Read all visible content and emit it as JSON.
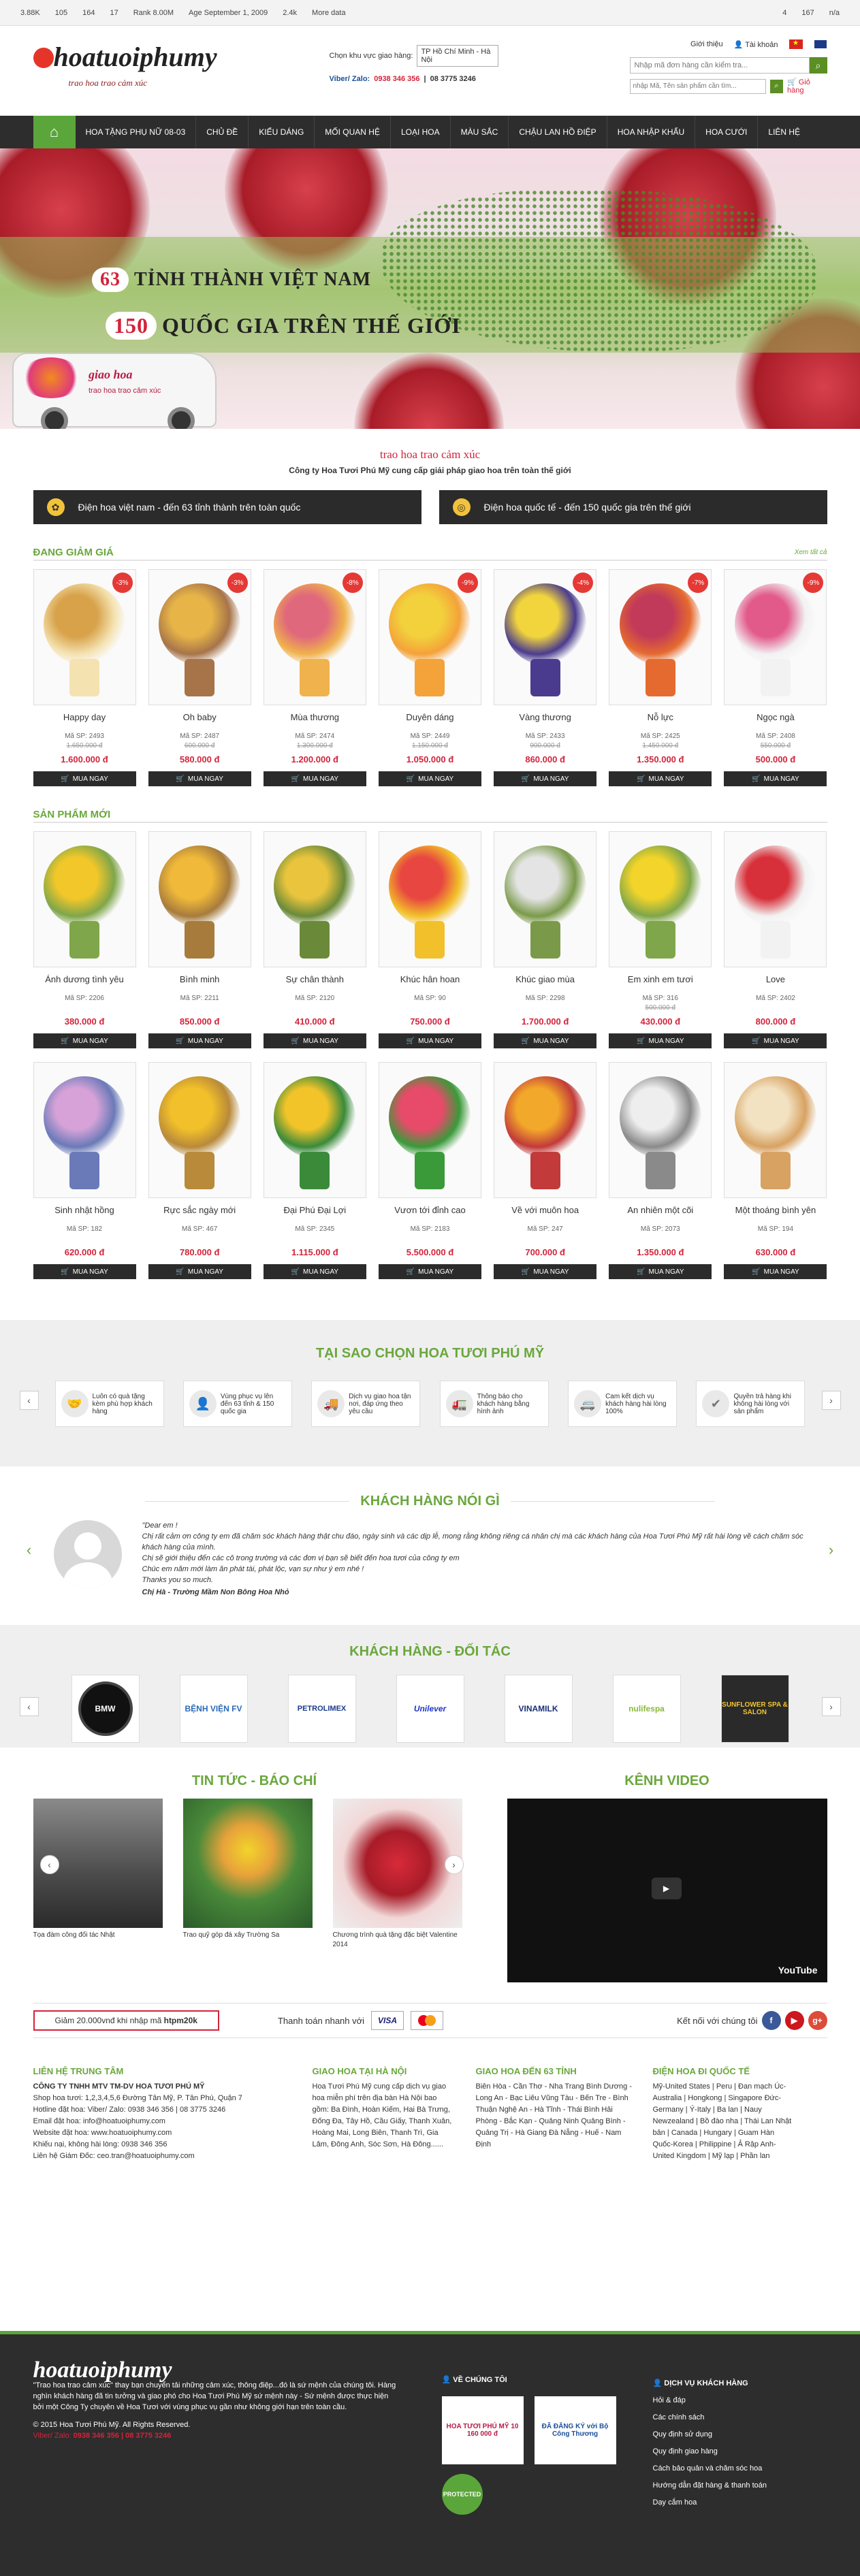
{
  "seobar": {
    "items": [
      "3.88K",
      "105",
      "164",
      "17",
      "Rank 8.00M",
      "Age September 1, 2009",
      "2.4k",
      "More data"
    ],
    "right": [
      "4",
      "167",
      "n/a"
    ]
  },
  "header": {
    "logo_text": "hoatuoiphumy",
    "logo_sub": ".com",
    "slogan": "trao hoa trao cảm xúc",
    "region_label": "Chọn khu vực giao hàng:",
    "region_value": "TP Hồ Chí Minh - Hà Nội",
    "hotline_label": "Viber/ Zalo:",
    "hotline1": "0938 346 356",
    "hotline2": "08 3775 3246",
    "intro": "Giới thiệu",
    "account": "Tài khoản",
    "search_placeholder": "Nhập mã đơn hàng cần kiểm tra...",
    "search2_placeholder": "nhập Mã, Tên sản phẩm cần tìm...",
    "cart": "Giỏ hàng"
  },
  "nav": [
    "HOA TẶNG PHỤ NỮ 08-03",
    "CHỦ ĐỀ",
    "KIỂU DÁNG",
    "MỐI QUAN HỆ",
    "LOẠI HOA",
    "MÀU SẮC",
    "CHẬU LAN HỒ ĐIỆP",
    "HOA NHẬP KHẨU",
    "HOA CƯỚI",
    "LIÊN HỆ"
  ],
  "banner": {
    "num1": "63",
    "text1": "TỈNH THÀNH VIỆT NAM",
    "num2": "150",
    "text2": "QUỐC GIA TRÊN THẾ GIỚI",
    "van_logo": "giao hoa",
    "van_sub": "trao hoa trao cảm xúc"
  },
  "tagline": {
    "title": "trao hoa trao cảm xúc",
    "sub": "Công ty Hoa Tươi Phú Mỹ cung cấp giải pháp giao hoa trên toàn thế giới"
  },
  "boxes": [
    "Điện hoa việt nam - đến 63 tỉnh thành trên toàn quốc",
    "Điện hoa quốc tế - đến 150 quốc gia trên thế giới"
  ],
  "sale": {
    "title": "ĐANG GIẢM GIÁ",
    "all": "Xem tất cả",
    "products": [
      {
        "name": "Happy day",
        "code": "Mã SP: 2493",
        "old": "1.650.000 đ",
        "price": "1.600.000 đ",
        "disc": "-3%",
        "c1": "#d8a24a",
        "c2": "#f4e2b0"
      },
      {
        "name": "Oh baby",
        "code": "Mã SP: 2487",
        "old": "600.000 đ",
        "price": "580.000 đ",
        "disc": "-3%",
        "c1": "#e6b447",
        "c2": "#a7744a"
      },
      {
        "name": "Mùa thương",
        "code": "Mã SP: 2474",
        "old": "1.300.000 đ",
        "price": "1.200.000 đ",
        "disc": "-8%",
        "c1": "#e0687c",
        "c2": "#f0b24d"
      },
      {
        "name": "Duyên dáng",
        "code": "Mã SP: 2449",
        "old": "1.150.000 đ",
        "price": "1.050.000 đ",
        "disc": "-9%",
        "c1": "#f2d13c",
        "c2": "#f4a23a"
      },
      {
        "name": "Vàng thương",
        "code": "Mã SP: 2433",
        "old": "900.000 đ",
        "price": "860.000 đ",
        "disc": "-4%",
        "c1": "#f2d53c",
        "c2": "#4a3b8e"
      },
      {
        "name": "Nỗ lực",
        "code": "Mã SP: 2425",
        "old": "1.450.000 đ",
        "price": "1.350.000 đ",
        "disc": "-7%",
        "c1": "#c23a59",
        "c2": "#e56a2f"
      },
      {
        "name": "Ngọc ngà",
        "code": "Mã SP: 2408",
        "old": "550.000 đ",
        "price": "500.000 đ",
        "disc": "-9%",
        "c1": "#e25a8a",
        "c2": "#f2f2f2"
      }
    ]
  },
  "newp": {
    "title": "SẢN PHẨM MỚI",
    "row1": [
      {
        "name": "Ánh dương tình yêu",
        "code": "Mã SP: 2206",
        "old": "",
        "price": "380.000 đ",
        "c1": "#f2c72a",
        "c2": "#7fa64a"
      },
      {
        "name": "Bình minh",
        "code": "Mã SP: 2211",
        "old": "",
        "price": "850.000 đ",
        "c1": "#f0b93a",
        "c2": "#a77b3c"
      },
      {
        "name": "Sự chân thành",
        "code": "Mã SP: 2120",
        "old": "",
        "price": "410.000 đ",
        "c1": "#e9c43c",
        "c2": "#6a8a3a"
      },
      {
        "name": "Khúc hân hoan",
        "code": "Mã SP: 90",
        "old": "",
        "price": "750.000 đ",
        "c1": "#e84640",
        "c2": "#f2c02a"
      },
      {
        "name": "Khúc giao mùa",
        "code": "Mã SP: 2298",
        "old": "",
        "price": "1.700.000 đ",
        "c1": "#e4e4e4",
        "c2": "#7a9a4a"
      },
      {
        "name": "Em xinh em tươi",
        "code": "Mã SP: 316",
        "old": "500.000 đ",
        "price": "430.000 đ",
        "c1": "#f2d42a",
        "c2": "#7fa64a"
      },
      {
        "name": "Love",
        "code": "Mã SP: 2402",
        "old": "",
        "price": "800.000 đ",
        "c1": "#d8303a",
        "c2": "#f2f2f2"
      }
    ],
    "row2": [
      {
        "name": "Sinh nhật hồng",
        "code": "Mã SP: 182",
        "old": "",
        "price": "620.000 đ",
        "c1": "#d6a2d8",
        "c2": "#6a7ab8"
      },
      {
        "name": "Rực sắc ngày mới",
        "code": "Mã SP: 467",
        "old": "",
        "price": "780.000 đ",
        "c1": "#f2c02a",
        "c2": "#b88a3a"
      },
      {
        "name": "Đại Phú Đại Lợi",
        "code": "Mã SP: 2345",
        "old": "",
        "price": "1.115.000 đ",
        "c1": "#f2c42a",
        "c2": "#3a8a3a"
      },
      {
        "name": "Vươn tới đỉnh cao",
        "code": "Mã SP: 2183",
        "old": "",
        "price": "5.500.000 đ",
        "c1": "#e84a6a",
        "c2": "#3a9a3a"
      },
      {
        "name": "Về với muôn hoa",
        "code": "Mã SP: 247",
        "old": "",
        "price": "700.000 đ",
        "c1": "#f2a82a",
        "c2": "#c23a3a"
      },
      {
        "name": "An nhiên một cõi",
        "code": "Mã SP: 2073",
        "old": "",
        "price": "1.350.000 đ",
        "c1": "#eeeeee",
        "c2": "#8a8a8a"
      },
      {
        "name": "Một thoáng bình yên",
        "code": "Mã SP: 194",
        "old": "",
        "price": "630.000 đ",
        "c1": "#f2e2c2",
        "c2": "#d8a262"
      }
    ],
    "buy": "MUA NGAY"
  },
  "why": {
    "title": "TẠI SAO CHỌN HOA TƯƠI PHÚ MỸ",
    "items": [
      "Luôn có quà tặng kèm phù hợp khách hàng",
      "Vùng phục vụ lên đến 63 tỉnh & 150 quốc gia",
      "Dịch vụ giao hoa tận nơi, đáp ứng theo yêu cầu",
      "Thông báo cho khách hàng bằng hình ảnh",
      "Cam kết dịch vụ khách hàng hài lòng 100%",
      "Quyền trả hàng khi không hài lòng với sản phẩm"
    ]
  },
  "testimonial": {
    "title": "KHÁCH HÀNG NÓI GÌ",
    "greeting": "\"Dear em !",
    "l1": "Chị rất cảm ơn công ty em đã chăm sóc khách hàng thật chu đáo, ngày sinh và các dịp lễ, mong rằng không riêng cá nhân chị mà các khách hàng của Hoa Tươi Phú Mỹ rất hài lòng về cách chăm sóc khách hàng của mình.",
    "l2": "Chị sẽ giới thiệu đến các cô trong trường và các đơn vị bạn sẽ biết đến hoa tươi của công ty em",
    "l3": "Chúc em năm mới làm ăn phát tài, phát lộc, vạn sự như ý em nhé !",
    "l4": "Thanks you so much.",
    "sign": "Chị Hà - Trường Mầm Non Bông Hoa Nhỏ"
  },
  "partners": {
    "title": "KHÁCH HÀNG - ĐỐI TÁC",
    "logos": [
      "BMW",
      "BỆNH VIỆN FV",
      "PETROLIMEX",
      "Unilever",
      "VINAMILK",
      "nulifespa",
      "SUNFLOWER SPA & SALON"
    ]
  },
  "news": {
    "title": "TIN TỨC - BÁO CHÍ",
    "items": [
      "Tọa đàm công đối tác Nhật",
      "Trao quỹ góp đá xây Trường Sa",
      "Chương trình quà tặng đặc biệt Valentine 2014"
    ]
  },
  "video": {
    "title": "KÊNH VIDEO",
    "brand": "YouTube"
  },
  "promo": {
    "code_text": "Giảm 20.000vnđ khi nhập mã",
    "code": "htpm20k",
    "pay": "Thanh toán nhanh với",
    "visa": "VISA",
    "connect": "Kết nối với chúng tôi"
  },
  "finfo": {
    "c1_title": "LIÊN HỆ TRUNG TÂM",
    "c1": [
      "CÔNG TY TNHH MTV TM-DV HOA TƯƠI PHÚ MỸ",
      "Shop hoa tươi: 1,2,3,4,5,6 Đường Tân Mỹ, P. Tân Phú, Quận 7",
      "Hotline đặt hoa: Viber/ Zalo: 0938 346 356 | 08 3775 3246",
      "Email đặt hoa: info@hoatuoiphumy.com",
      "Website đặt hoa: www.hoatuoiphumy.com",
      "Khiếu nại, không hài lòng: 0938 346 356",
      "Liên hệ Giám Đốc: ceo.tran@hoatuoiphumy.com"
    ],
    "c2_title": "GIAO HOA TẠI HÀ NỘI",
    "c2": "Hoa Tươi Phú Mỹ cung cấp dịch vụ giao hoa miễn phí trên địa bàn Hà Nội bao gồm: Ba Đình, Hoàn Kiếm, Hai Bà Trưng, Đống Đa, Tây Hồ, Cầu Giấy, Thanh Xuân, Hoàng Mai, Long Biên, Thanh Trì, Gia Lâm, Đông Anh, Sóc Sơn, Hà Đông......",
    "c3_title": "GIAO HOA ĐẾN 63 TỈNH",
    "c3": "Biên Hòa - Cần Thơ - Nha Trang Bình Dương - Long An - Bạc Liêu Vũng Tàu - Bến Tre - Bình Thuận Nghệ An - Hà Tĩnh - Thái Bình Hải Phòng - Bắc Kạn - Quảng Ninh Quảng Bình - Quảng Trị - Hà Giang Đà Nẵng - Huế - Nam Định",
    "c4_title": "ĐIỆN HOA ĐI QUỐC TẾ",
    "c4": "Mỹ-United States | Peru | Đan mạch Úc-Australia | Hongkong | Singapore Đức-Germany | Ý-Italy | Ba lan | Nauy Newzealand | Bồ đào nha | Thái Lan Nhật bản | Canada | Hungary | Guam Hàn Quốc-Korea | Philippine | Ả Rập Anh-United Kingdom | Mỹ lạp | Phần lan"
  },
  "dfoot": {
    "about": "\"Trao hoa trao cảm xúc\" thay bạn chuyển tải những cảm xúc, thông điệp...đó là sứ mệnh của chúng tôi. Hàng nghìn khách hàng đã tin tưởng và giao phó cho Hoa Tươi Phú Mỹ sứ mệnh này - Sứ mệnh được thực hiện bởi một Công Ty chuyên về Hoa Tươi với vùng phục vụ gần như không giới hạn trên toàn cầu.",
    "copy": "© 2015 Hoa Tươi Phú Mỹ. All Rights Reserved.",
    "hotline_label": "Viber/ Zalo:",
    "hotline": "0938 346 356 | 08 3775 3246",
    "about_title": "VỀ CHÚNG TÔI",
    "badge1": "HOA TƯƠI PHÚ MỸ 10 160 000 đ",
    "badge2": "ĐÃ ĐĂNG KÝ với Bộ Công Thương",
    "badge3": "PROTECTED",
    "support_title": "DỊCH VỤ KHÁCH HÀNG",
    "support": [
      "Hỏi & đáp",
      "Các chính sách",
      "Quy định sử dụng",
      "Quy định giao hàng",
      "Cách bảo quản và chăm sóc hoa",
      "Hướng dẫn đặt hàng & thanh toán",
      "Dạy cắm hoa"
    ]
  }
}
